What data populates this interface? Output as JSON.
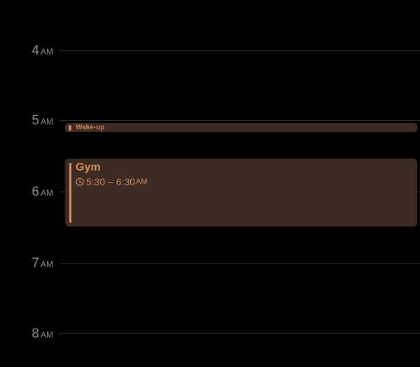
{
  "calendar": {
    "hours": [
      {
        "number": "4",
        "period": "AM"
      },
      {
        "number": "5",
        "period": "AM"
      },
      {
        "number": "6",
        "period": "AM"
      },
      {
        "number": "7",
        "period": "AM"
      },
      {
        "number": "8",
        "period": "AM"
      }
    ],
    "events": {
      "wake_up": {
        "title": "Wake-up"
      },
      "gym": {
        "title": "Gym",
        "time_range": "5:30 – 6:30",
        "time_period": "AM",
        "icon": "clock-icon"
      }
    },
    "colors": {
      "background": "#000000",
      "event_fill": "#3b2b23",
      "event_accent": "#d68c5a",
      "hour_label": "#8e8e93",
      "gridline": "#2f2f31"
    }
  }
}
